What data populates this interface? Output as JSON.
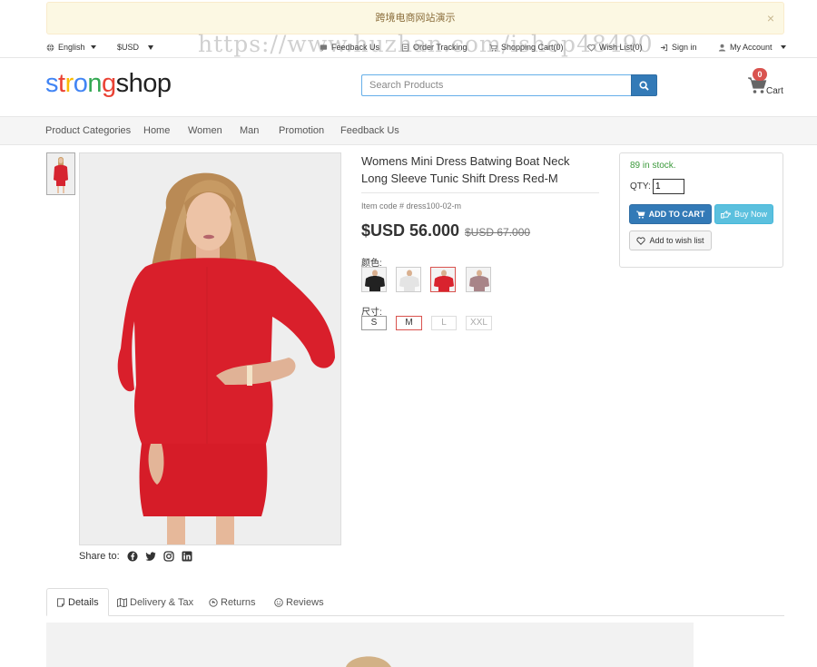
{
  "notice": {
    "text": "跨境电商网站演示",
    "close": "×"
  },
  "watermark": "https://www.huzhan.com/ishop48490",
  "topbar": {
    "language": "English",
    "currency": "$USD",
    "links": [
      {
        "label": "Feedback Us",
        "icon": "feedback-icon"
      },
      {
        "label": "Order Tracking",
        "icon": "order-icon"
      },
      {
        "label": "Shopping Cart(0)",
        "icon": "cart-icon"
      },
      {
        "label": "Wish List(0)",
        "icon": "heart-icon"
      },
      {
        "label": "Sign in",
        "icon": "signin-icon"
      },
      {
        "label": "My Account",
        "icon": "user-icon"
      }
    ]
  },
  "header": {
    "logo_letters": [
      {
        "ch": "s",
        "color": "#4285f4"
      },
      {
        "ch": "t",
        "color": "#ea4335"
      },
      {
        "ch": "r",
        "color": "#fbbc05"
      },
      {
        "ch": "o",
        "color": "#4285f4"
      },
      {
        "ch": "n",
        "color": "#34a853"
      },
      {
        "ch": "g",
        "color": "#ea4335"
      },
      {
        "ch": "shop",
        "color": "#222222"
      }
    ],
    "search_placeholder": "Search Products",
    "cart_count": "0",
    "cart_label": "Cart"
  },
  "nav": [
    "Product Categories",
    "Home",
    "Women",
    "Man",
    "Promotion",
    "Feedback Us"
  ],
  "product": {
    "title": "Womens Mini Dress Batwing Boat Neck Long Sleeve Tunic Shift Dress Red-M",
    "item_code": "Item code # dress100-02-m",
    "price": "$USD 56.000",
    "old_price": "$USD 67.000",
    "color_label": "颜色:",
    "colors": [
      {
        "name": "black",
        "hex": "#222222"
      },
      {
        "name": "white",
        "hex": "#f2f2f2"
      },
      {
        "name": "red",
        "hex": "#d9232e"
      },
      {
        "name": "mauve",
        "hex": "#a88488"
      }
    ],
    "selected_color": 2,
    "size_label": "尺寸:",
    "sizes": [
      "S",
      "M",
      "L",
      "XXL"
    ],
    "selected_size": 1,
    "share_label": "Share to:",
    "share_icons": [
      "facebook-icon",
      "twitter-icon",
      "instagram-icon",
      "linkedin-icon"
    ]
  },
  "buybox": {
    "stock": "89 in stock.",
    "qty_label": "QTY:",
    "qty_value": "1",
    "add_to_cart": "ADD TO CART",
    "buy_now": "Buy Now",
    "wishlist": "Add to wish list"
  },
  "tabs": [
    {
      "label": "Details",
      "icon": "details-icon"
    },
    {
      "label": "Delivery & Tax",
      "icon": "map-icon"
    },
    {
      "label": "Returns",
      "icon": "returns-icon"
    },
    {
      "label": "Reviews",
      "icon": "smile-icon"
    }
  ],
  "colors": {
    "primary": "#337ab7",
    "info": "#5bc0de",
    "stock": "#3c9a3c",
    "badge": "#d9534f"
  }
}
